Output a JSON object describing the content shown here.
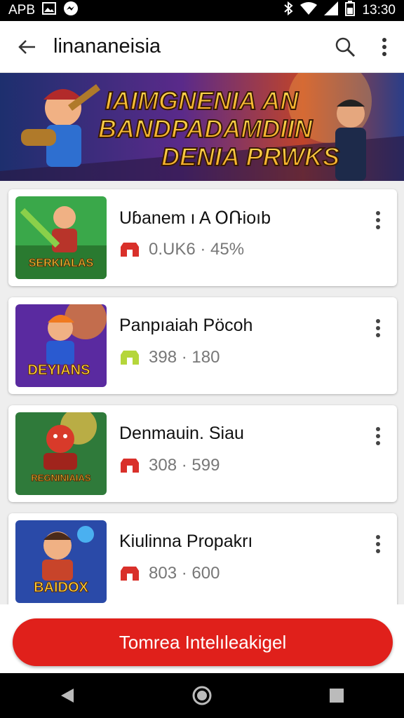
{
  "status_bar": {
    "left_text": "APB",
    "time": "13:30",
    "icons": [
      "image-icon",
      "messenger-icon",
      "bluetooth-icon",
      "wifi-icon",
      "signal-icon",
      "battery-icon"
    ]
  },
  "app_bar": {
    "title": "linananeisia",
    "icons": [
      "back-arrow-icon",
      "search-icon",
      "more-vert-icon"
    ]
  },
  "banner": {
    "lines": [
      "IAIMGNENIA AN",
      "BANDPADAMDIIN",
      "DENIA PRWKS"
    ]
  },
  "games": [
    {
      "title": "Uɓanem ı A ՕՌioıb",
      "stats": "0.UK6 · 45%",
      "thumb_text": "SERKIALAS",
      "icon_color": "#d9302a"
    },
    {
      "title": "Panpıaiah Pöcoh",
      "stats": "398 · 180",
      "thumb_text": "DEYIANS",
      "icon_color": "#b5d63a"
    },
    {
      "title": "Denmauin. Siau",
      "stats": "308 · 599",
      "thumb_text": "REGNINIAIAS",
      "icon_color": "#d9302a"
    },
    {
      "title": "Kiulinna Propakrı",
      "stats": "803 · 600",
      "thumb_text": "BAIDOX",
      "icon_color": "#d9302a"
    }
  ],
  "cta": {
    "label": "Tomrea Intelıleakigel"
  },
  "colors": {
    "accent": "#e0201b",
    "status_bar": "#000000",
    "nav_bar": "#000000"
  },
  "nav_bar": {
    "icons": [
      "back-triangle-icon",
      "home-circle-icon",
      "recents-square-icon"
    ]
  }
}
